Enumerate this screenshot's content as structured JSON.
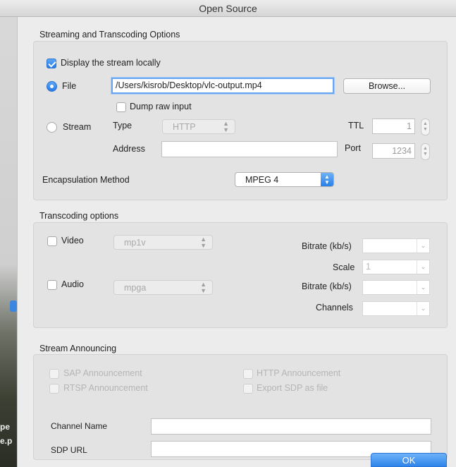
{
  "window": {
    "title": "Open Source"
  },
  "background": {
    "fragments": [
      "pe",
      "e.p"
    ]
  },
  "streaming": {
    "section_title": "Streaming and Transcoding Options",
    "display_locally_label": "Display the stream locally",
    "display_locally_checked": true,
    "file_label": "File",
    "file_path": "/Users/kisrob/Desktop/vlc-output.mp4",
    "browse_label": "Browse...",
    "dump_raw_label": "Dump raw input",
    "dump_raw_checked": false,
    "stream_label": "Stream",
    "type_label": "Type",
    "type_value": "HTTP",
    "ttl_label": "TTL",
    "ttl_value": "1",
    "address_label": "Address",
    "address_value": "",
    "port_label": "Port",
    "port_value": "1234",
    "encapsulation_label": "Encapsulation Method",
    "encapsulation_value": "MPEG 4"
  },
  "transcoding": {
    "section_title": "Transcoding options",
    "video_label": "Video",
    "video_codec": "mp1v",
    "video_bitrate_label": "Bitrate (kb/s)",
    "video_bitrate_value": "",
    "scale_label": "Scale",
    "scale_value": "1",
    "audio_label": "Audio",
    "audio_codec": "mpga",
    "audio_bitrate_label": "Bitrate (kb/s)",
    "audio_bitrate_value": "",
    "channels_label": "Channels",
    "channels_value": ""
  },
  "announcing": {
    "section_title": "Stream Announcing",
    "sap_label": "SAP Announcement",
    "rtsp_label": "RTSP Announcement",
    "http_label": "HTTP Announcement",
    "export_sdp_label": "Export SDP as file",
    "channel_name_label": "Channel Name",
    "channel_name_value": "",
    "sdp_url_label": "SDP URL",
    "sdp_url_value": ""
  },
  "actions": {
    "ok_label": "OK"
  },
  "colors": {
    "accent": "#2f84ea",
    "focus_ring": "#6aa6ef",
    "group_bg": "#e3e3e3"
  },
  "icons": {
    "popup_arrows": "updown-arrows-icon",
    "combo_arrow": "chevron-down-icon",
    "stepper": "stepper-arrows-icon"
  }
}
